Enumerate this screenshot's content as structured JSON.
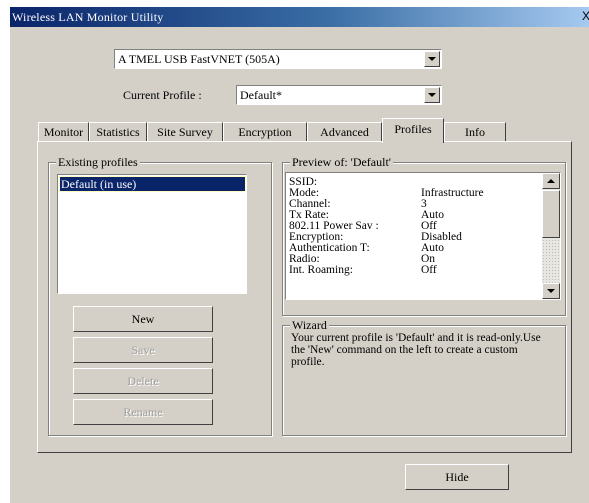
{
  "window": {
    "title": "Wireless LAN Monitor Utility",
    "close_glyph": "X"
  },
  "adapter": {
    "value": "A TMEL USB FastVNET (505A)"
  },
  "profile": {
    "label": "Current Profile :",
    "value": "Default*"
  },
  "tabs": [
    {
      "label": "Monitor"
    },
    {
      "label": "Statistics"
    },
    {
      "label": "Site Survey"
    },
    {
      "label": "Encryption"
    },
    {
      "label": "Advanced"
    },
    {
      "label": "Profiles"
    },
    {
      "label": "Info"
    }
  ],
  "active_tab": "Profiles",
  "existing": {
    "legend": "Existing profiles",
    "items": [
      {
        "label": "Default (in use)"
      }
    ]
  },
  "buttons": {
    "new": "New",
    "save": "Save",
    "delete": "Delete",
    "rename": "Rename",
    "hide": "Hide"
  },
  "preview": {
    "legend": "Preview of: 'Default'",
    "rows": [
      {
        "k": "SSID:",
        "v": ""
      },
      {
        "k": "Mode:",
        "v": "Infrastructure"
      },
      {
        "k": "Channel:",
        "v": "3"
      },
      {
        "k": "Tx Rate:",
        "v": "Auto"
      },
      {
        "k": "802.11 Power Sav :",
        "v": "Off"
      },
      {
        "k": "Encryption:",
        "v": "Disabled"
      },
      {
        "k": "Authentication T:",
        "v": "Auto"
      },
      {
        "k": "Radio:",
        "v": "On"
      },
      {
        "k": "Int. Roaming:",
        "v": "Off"
      }
    ]
  },
  "wizard": {
    "legend": "Wizard",
    "text": "Your current profile is 'Default' and it is read-only.Use the 'New' command on the left to create a custom profile."
  }
}
